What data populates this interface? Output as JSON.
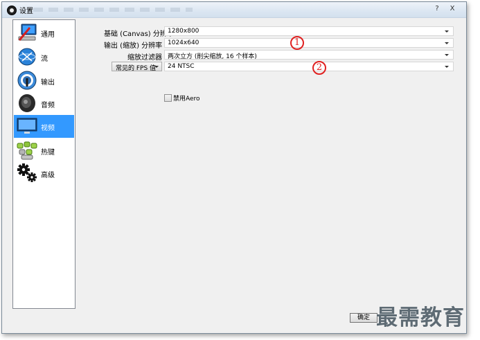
{
  "window": {
    "title": "设置",
    "help_button": "?",
    "close_button": "X"
  },
  "sidebar": {
    "items": [
      {
        "label": "通用",
        "icon": "general-settings-icon"
      },
      {
        "label": "流",
        "icon": "stream-globe-icon"
      },
      {
        "label": "输出",
        "icon": "output-broadcast-icon"
      },
      {
        "label": "音频",
        "icon": "audio-speaker-icon"
      },
      {
        "label": "视频",
        "icon": "video-monitor-icon"
      },
      {
        "label": "热键",
        "icon": "hotkeys-keyboard-icon"
      },
      {
        "label": "高级",
        "icon": "advanced-gears-icon"
      }
    ],
    "selected": "视频"
  },
  "video": {
    "base_resolution": {
      "label": "基础 (Canvas) 分辨率",
      "value": "1280x800"
    },
    "output_resolution": {
      "label": "输出 (缩放) 分辨率",
      "value": "1024x640"
    },
    "downscale_filter": {
      "label": "缩放过滤器",
      "value": "两次立方 (削尖缩放, 16 个样本)"
    },
    "fps": {
      "type_value": "常见的 FPS 值",
      "value": "24 NTSC"
    },
    "disable_aero": {
      "label": "禁用Aero",
      "checked": false
    }
  },
  "annotations": {
    "marker_1": "1",
    "marker_2": "2",
    "color": "#e02020"
  },
  "footer": {
    "ok_label": "确定",
    "watermark": "最需教育"
  },
  "colors": {
    "selection": "#3399ff",
    "window_bg": "#f0f0f0"
  }
}
